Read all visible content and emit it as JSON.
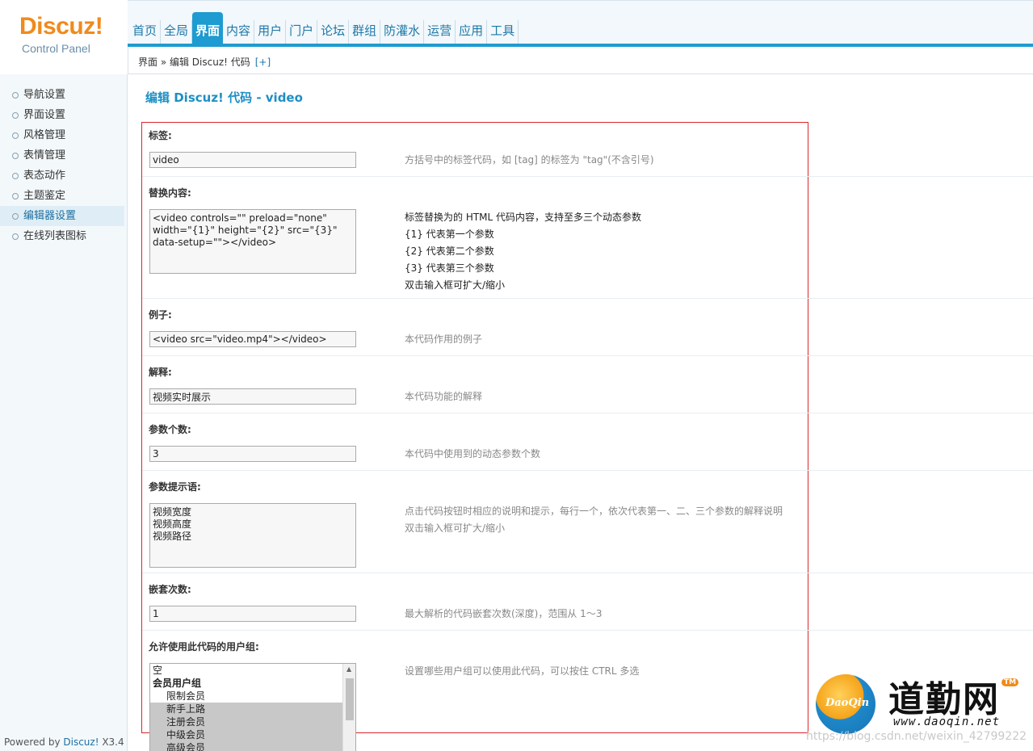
{
  "logo": {
    "brand": "Discuz!",
    "subtitle": "Control Panel"
  },
  "topnav": {
    "items": [
      "首页",
      "全局",
      "界面",
      "内容",
      "用户",
      "门户",
      "论坛",
      "群组",
      "防灌水",
      "运营",
      "应用",
      "工具"
    ],
    "active": "界面"
  },
  "breadcrumb": {
    "path": "界面 » 编辑 Discuz! 代码",
    "plus": "[+]"
  },
  "sidebar": {
    "items": [
      "导航设置",
      "界面设置",
      "风格管理",
      "表情管理",
      "表态动作",
      "主题鉴定",
      "编辑器设置",
      "在线列表图标"
    ],
    "active_index": 6
  },
  "footer": {
    "powered_prefix": "Powered by ",
    "powered_link": "Discuz!",
    "version": " X3.4"
  },
  "page": {
    "title": "编辑 Discuz! 代码 - video"
  },
  "form": {
    "tag": {
      "label": "标签:",
      "value": "video",
      "tip": "方括号中的标签代码，如 [tag] 的标签为 \"tag\"(不含引号)"
    },
    "replace": {
      "label": "替换内容:",
      "value": "<video controls=\"\" preload=\"none\"\nwidth=\"{1}\" height=\"{2}\" src=\"{3}\"\ndata-setup=\"\"></video>",
      "tips": [
        "标签替换为的 HTML 代码内容，支持至多三个动态参数",
        "{1} 代表第一个参数",
        "{2} 代表第二个参数",
        "{3} 代表第三个参数",
        "双击输入框可扩大/缩小"
      ]
    },
    "example": {
      "label": "例子:",
      "value": "<video src=\"video.mp4\"></video>",
      "tip": "本代码作用的例子"
    },
    "explain": {
      "label": "解释:",
      "value": "视频实时展示",
      "tip": "本代码功能的解释"
    },
    "param_count": {
      "label": "参数个数:",
      "value": "3",
      "tip": "本代码中使用到的动态参数个数"
    },
    "param_prompt": {
      "label": "参数提示语:",
      "value": "视频宽度\n视频高度\n视频路径",
      "tips": [
        "点击代码按钮时相应的说明和提示，每行一个，依次代表第一、二、三个参数的解释说明",
        "双击输入框可扩大/缩小"
      ]
    },
    "nest": {
      "label": "嵌套次数:",
      "value": "1",
      "tip": "最大解析的代码嵌套次数(深度)，范围从 1～3"
    },
    "groups": {
      "label": "允许使用此代码的用户组:",
      "tip": "设置哪些用户组可以使用此代码，可以按住 CTRL 多选",
      "options": [
        {
          "text": "空",
          "kind": "plain",
          "selected": false
        },
        {
          "text": "会员用户组",
          "kind": "group",
          "selected": false
        },
        {
          "text": "限制会员",
          "kind": "sub",
          "selected": false
        },
        {
          "text": "新手上路",
          "kind": "sub",
          "selected": true
        },
        {
          "text": "注册会员",
          "kind": "sub",
          "selected": true
        },
        {
          "text": "中级会员",
          "kind": "sub",
          "selected": true
        },
        {
          "text": "高级会员",
          "kind": "sub",
          "selected": true
        }
      ]
    }
  },
  "watermark": {
    "ball_text": "DaoQin",
    "cn": "道勤网",
    "tm": "TM",
    "url": "www.daoqin.net",
    "csdn": "https://blog.csdn.net/weixin_42799222"
  }
}
